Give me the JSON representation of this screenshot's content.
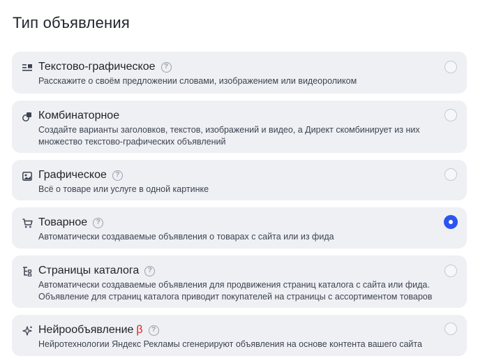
{
  "page": {
    "title": "Тип объявления"
  },
  "options": [
    {
      "icon": "text-graphic-icon",
      "title": "Текстово-графическое",
      "beta": "",
      "has_help": true,
      "description": "Расскажите о своём предложении словами, изображением или видеороликом",
      "selected": false
    },
    {
      "icon": "combinatorial-icon",
      "title": "Комбинаторное",
      "beta": "",
      "has_help": false,
      "description": "Создайте варианты заголовков, текстов, изображений и видео, а Директ скомбинирует из них множество текстово-графических объявлений",
      "selected": false
    },
    {
      "icon": "image-icon",
      "title": "Графическое",
      "beta": "",
      "has_help": true,
      "description": "Всё о товаре или услуге в одной картинке",
      "selected": false
    },
    {
      "icon": "cart-icon",
      "title": "Товарное",
      "beta": "",
      "has_help": true,
      "description": "Автоматически создаваемые объявления о товарах с сайта или из фида",
      "selected": true
    },
    {
      "icon": "catalog-tree-icon",
      "title": "Страницы каталога",
      "beta": "",
      "has_help": true,
      "description": "Автоматически создаваемые объявления для продвижения страниц каталога с сайта или фида. Объявление для страниц каталога приводит покупателей на страницы с ассортиментом товаров",
      "selected": false
    },
    {
      "icon": "sparkle-icon",
      "title": "Нейрообъявление",
      "beta": "β",
      "has_help": true,
      "description": "Нейротехнологии Яндекс Рекламы сгенерируют объявления на основе контента вашего сайта",
      "selected": false
    }
  ],
  "help_glyph": "?",
  "colors": {
    "card_bg": "#eef0f4",
    "accent": "#2c54f0",
    "beta": "#e31b1b"
  }
}
